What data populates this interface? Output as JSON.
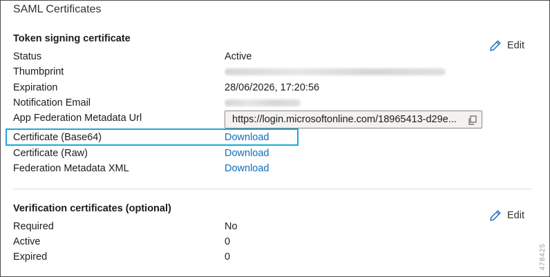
{
  "panel": {
    "title": "SAML Certificates"
  },
  "token_signing": {
    "heading": "Token signing certificate",
    "edit_label": "Edit",
    "rows": [
      {
        "label": "Status",
        "value": "Active"
      },
      {
        "label": "Thumbprint"
      },
      {
        "label": "Expiration",
        "value": "28/06/2026, 17:20:56"
      },
      {
        "label": "Notification Email"
      },
      {
        "label": "App Federation Metadata Url",
        "value": "https://login.microsoftonline.com/18965413-d29e..."
      },
      {
        "label": "Certificate (Base64)",
        "link": "Download"
      },
      {
        "label": "Certificate (Raw)",
        "link": "Download"
      },
      {
        "label": "Federation Metadata XML",
        "link": "Download"
      }
    ]
  },
  "verification": {
    "heading": "Verification certificates (optional)",
    "edit_label": "Edit",
    "rows": [
      {
        "label": "Required",
        "value": "No"
      },
      {
        "label": "Active",
        "value": "0"
      },
      {
        "label": "Expired",
        "value": "0"
      }
    ]
  },
  "figure_number": "478425",
  "icons": {
    "edit": "pencil-icon",
    "copy": "copy-icon"
  },
  "colors": {
    "link": "#0f6cbd",
    "highlight": "#1aa8d6",
    "border": "#4a4a4a"
  }
}
